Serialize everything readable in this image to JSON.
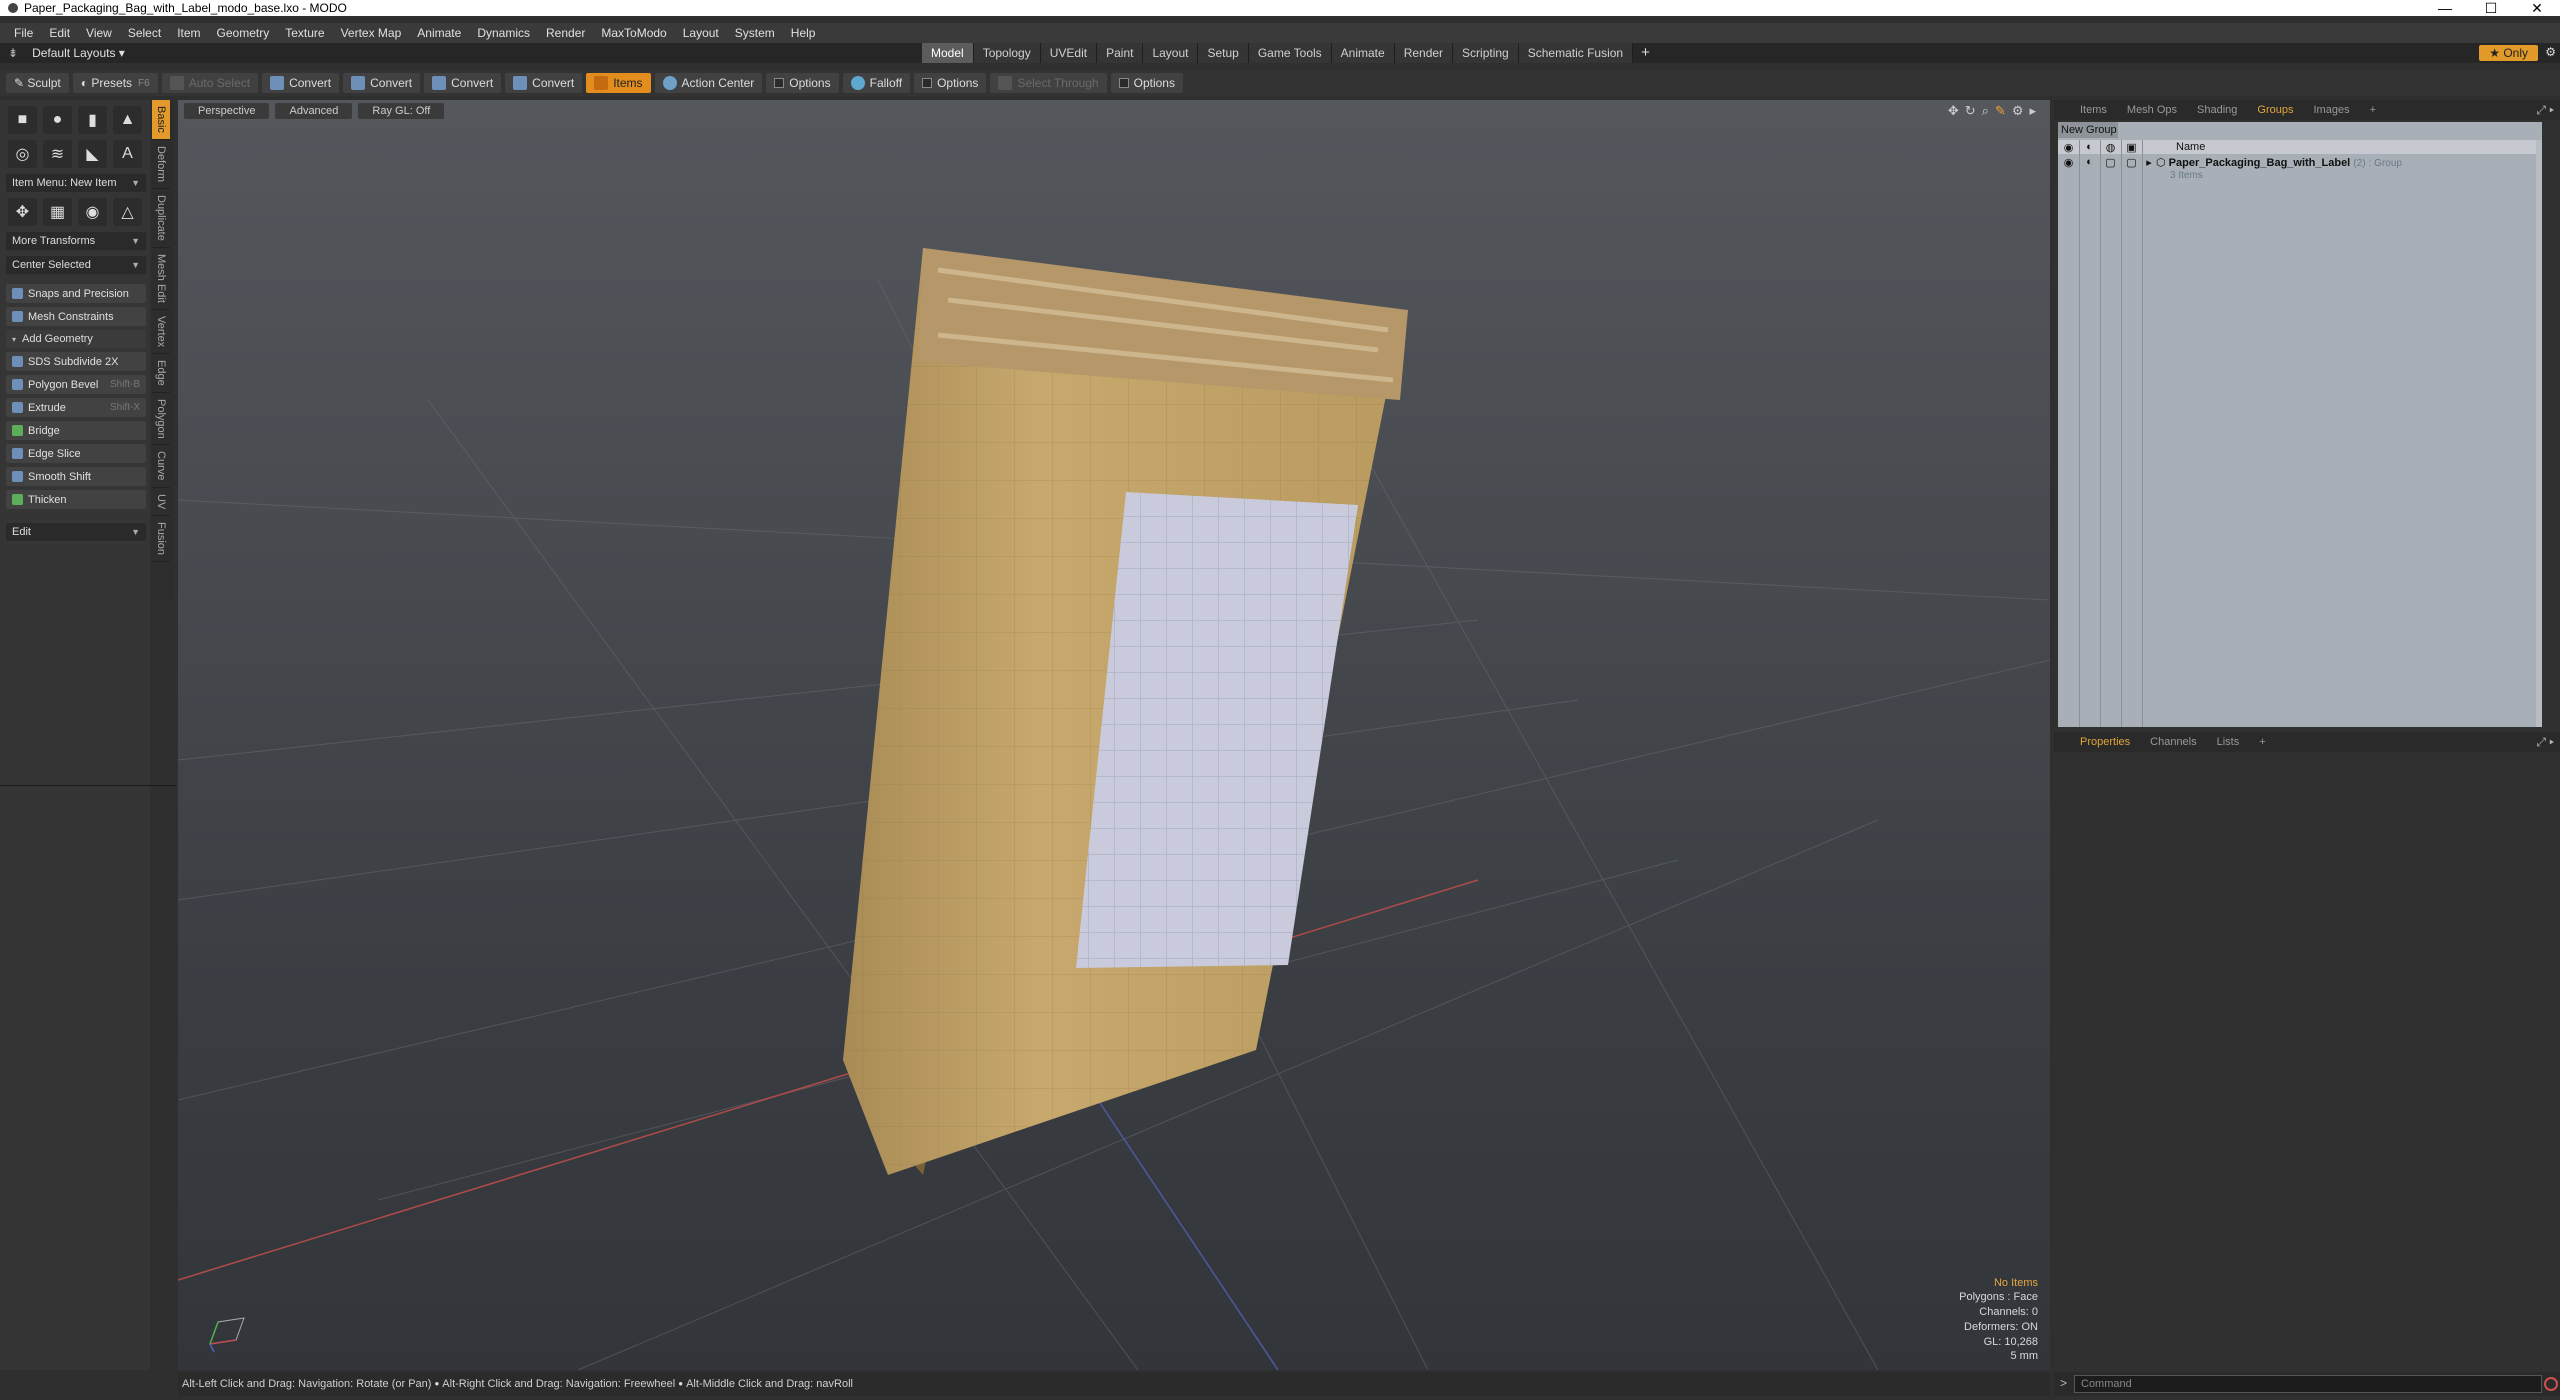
{
  "window": {
    "title": "Paper_Packaging_Bag_with_Label_modo_base.lxo - MODO",
    "minimize": "—",
    "maximize": "☐",
    "close": "✕"
  },
  "menu": [
    "File",
    "Edit",
    "View",
    "Select",
    "Item",
    "Geometry",
    "Texture",
    "Vertex Map",
    "Animate",
    "Dynamics",
    "Render",
    "MaxToModo",
    "Layout",
    "System",
    "Help"
  ],
  "layoutbar": {
    "layouts": "Default Layouts ▾",
    "tabs": [
      "Model",
      "Topology",
      "UVEdit",
      "Paint",
      "Layout",
      "Setup",
      "Game Tools",
      "Animate",
      "Render",
      "Scripting",
      "Schematic Fusion"
    ],
    "active_tab": "Model",
    "plus": "+",
    "only": "★ Only"
  },
  "toolbar": {
    "sculpt": "Sculpt",
    "presets": "Presets",
    "presets_key": "F6",
    "auto_select": "Auto Select",
    "convert": "Convert",
    "items": "Items",
    "action_center": "Action Center",
    "options": "Options",
    "falloff": "Falloff",
    "select_through": "Select Through"
  },
  "left": {
    "item_menu": "Item Menu: New Item",
    "more_transforms": "More Transforms",
    "center_selected": "Center Selected",
    "snaps": "Snaps and Precision",
    "mesh_constraints": "Mesh Constraints",
    "add_geometry": "Add Geometry",
    "tools": [
      {
        "label": "SDS Subdivide 2X",
        "shortcut": ""
      },
      {
        "label": "Polygon Bevel",
        "shortcut": "Shift-B"
      },
      {
        "label": "Extrude",
        "shortcut": "Shift-X"
      },
      {
        "label": "Bridge",
        "shortcut": ""
      },
      {
        "label": "Edge Slice",
        "shortcut": ""
      },
      {
        "label": "Smooth Shift",
        "shortcut": ""
      },
      {
        "label": "Thicken",
        "shortcut": ""
      }
    ],
    "edit": "Edit",
    "vtabs": [
      "Basic",
      "Deform",
      "Duplicate",
      "Mesh Edit",
      "Vertex",
      "Edge",
      "Polygon",
      "Curve",
      "UV",
      "Fusion"
    ]
  },
  "viewport": {
    "perspective": "Perspective",
    "advanced": "Advanced",
    "raygl": "Ray GL: Off",
    "hud": [
      "No Items",
      "Polygons : Face",
      "Channels: 0",
      "Deformers: ON",
      "GL: 10,268",
      "5 mm"
    ]
  },
  "status": {
    "hints": [
      "Alt-Left Click and Drag: Navigation: Rotate (or Pan)",
      "Alt-Right Click and Drag: Navigation: Freewheel",
      "Alt-Middle Click and Drag: navRoll"
    ]
  },
  "right": {
    "tabs": [
      "Items",
      "Mesh Ops",
      "Shading",
      "Groups",
      "Images"
    ],
    "active_tab": "Groups",
    "new_group": "New Group",
    "name_header": "Name",
    "group_name": "Paper_Packaging_Bag_with_Label",
    "group_count": "(2)",
    "group_type": ": Group",
    "group_items": "3 Items",
    "prop_tabs": [
      "Properties",
      "Channels",
      "Lists"
    ],
    "prop_active": "Properties",
    "command_placeholder": "Command",
    "prompt": ">"
  }
}
